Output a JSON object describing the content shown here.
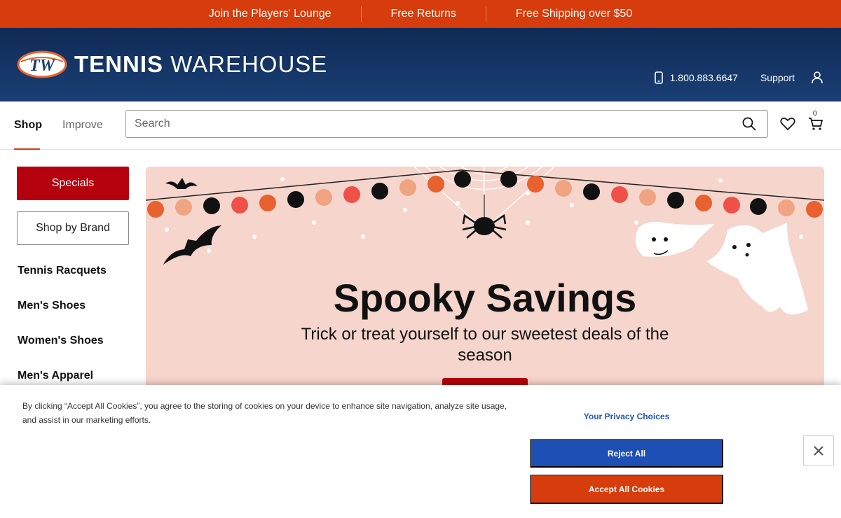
{
  "promo": {
    "items": [
      "Join the Players' Lounge",
      "Free Returns",
      "Free Shipping over $50"
    ]
  },
  "header": {
    "logo_mark": "TW",
    "brand_bold": "TENNIS",
    "brand_light": "WAREHOUSE",
    "phone": "1.800.883.6647",
    "support": "Support",
    "icons": [
      "phone-icon",
      "account-icon"
    ]
  },
  "nav": {
    "tabs": [
      {
        "label": "Shop",
        "active": true
      },
      {
        "label": "Improve",
        "active": false
      }
    ],
    "search_placeholder": "Search",
    "cart_count": "0",
    "icons": [
      "search-icon",
      "heart-icon",
      "cart-icon"
    ]
  },
  "sidebar": {
    "specials": "Specials",
    "shop_by_brand": "Shop by Brand",
    "categories": [
      "Tennis Racquets",
      "Men's Shoes",
      "Women's Shoes",
      "Men's Apparel"
    ]
  },
  "hero": {
    "title": "Spooky Savings",
    "subtitle": "Trick or treat yourself to our sweetest deals of the season",
    "colors": {
      "background": "#f6d5cc",
      "button": "#b5000d"
    }
  },
  "cookie_banner": {
    "text": "By clicking “Accept All Cookies”, you agree to the storing of cookies on your device to enhance site navigation, analyze site usage, and assist in our marketing efforts.",
    "privacy_link": "Your Privacy Choices",
    "reject": "Reject All",
    "accept": "Accept All Cookies",
    "close_icon": "close-icon"
  },
  "colors": {
    "brand_orange": "#d63c0c",
    "navy": "#0f2a56",
    "specials_red": "#b5000d",
    "reject_blue": "#1d4fb5"
  }
}
